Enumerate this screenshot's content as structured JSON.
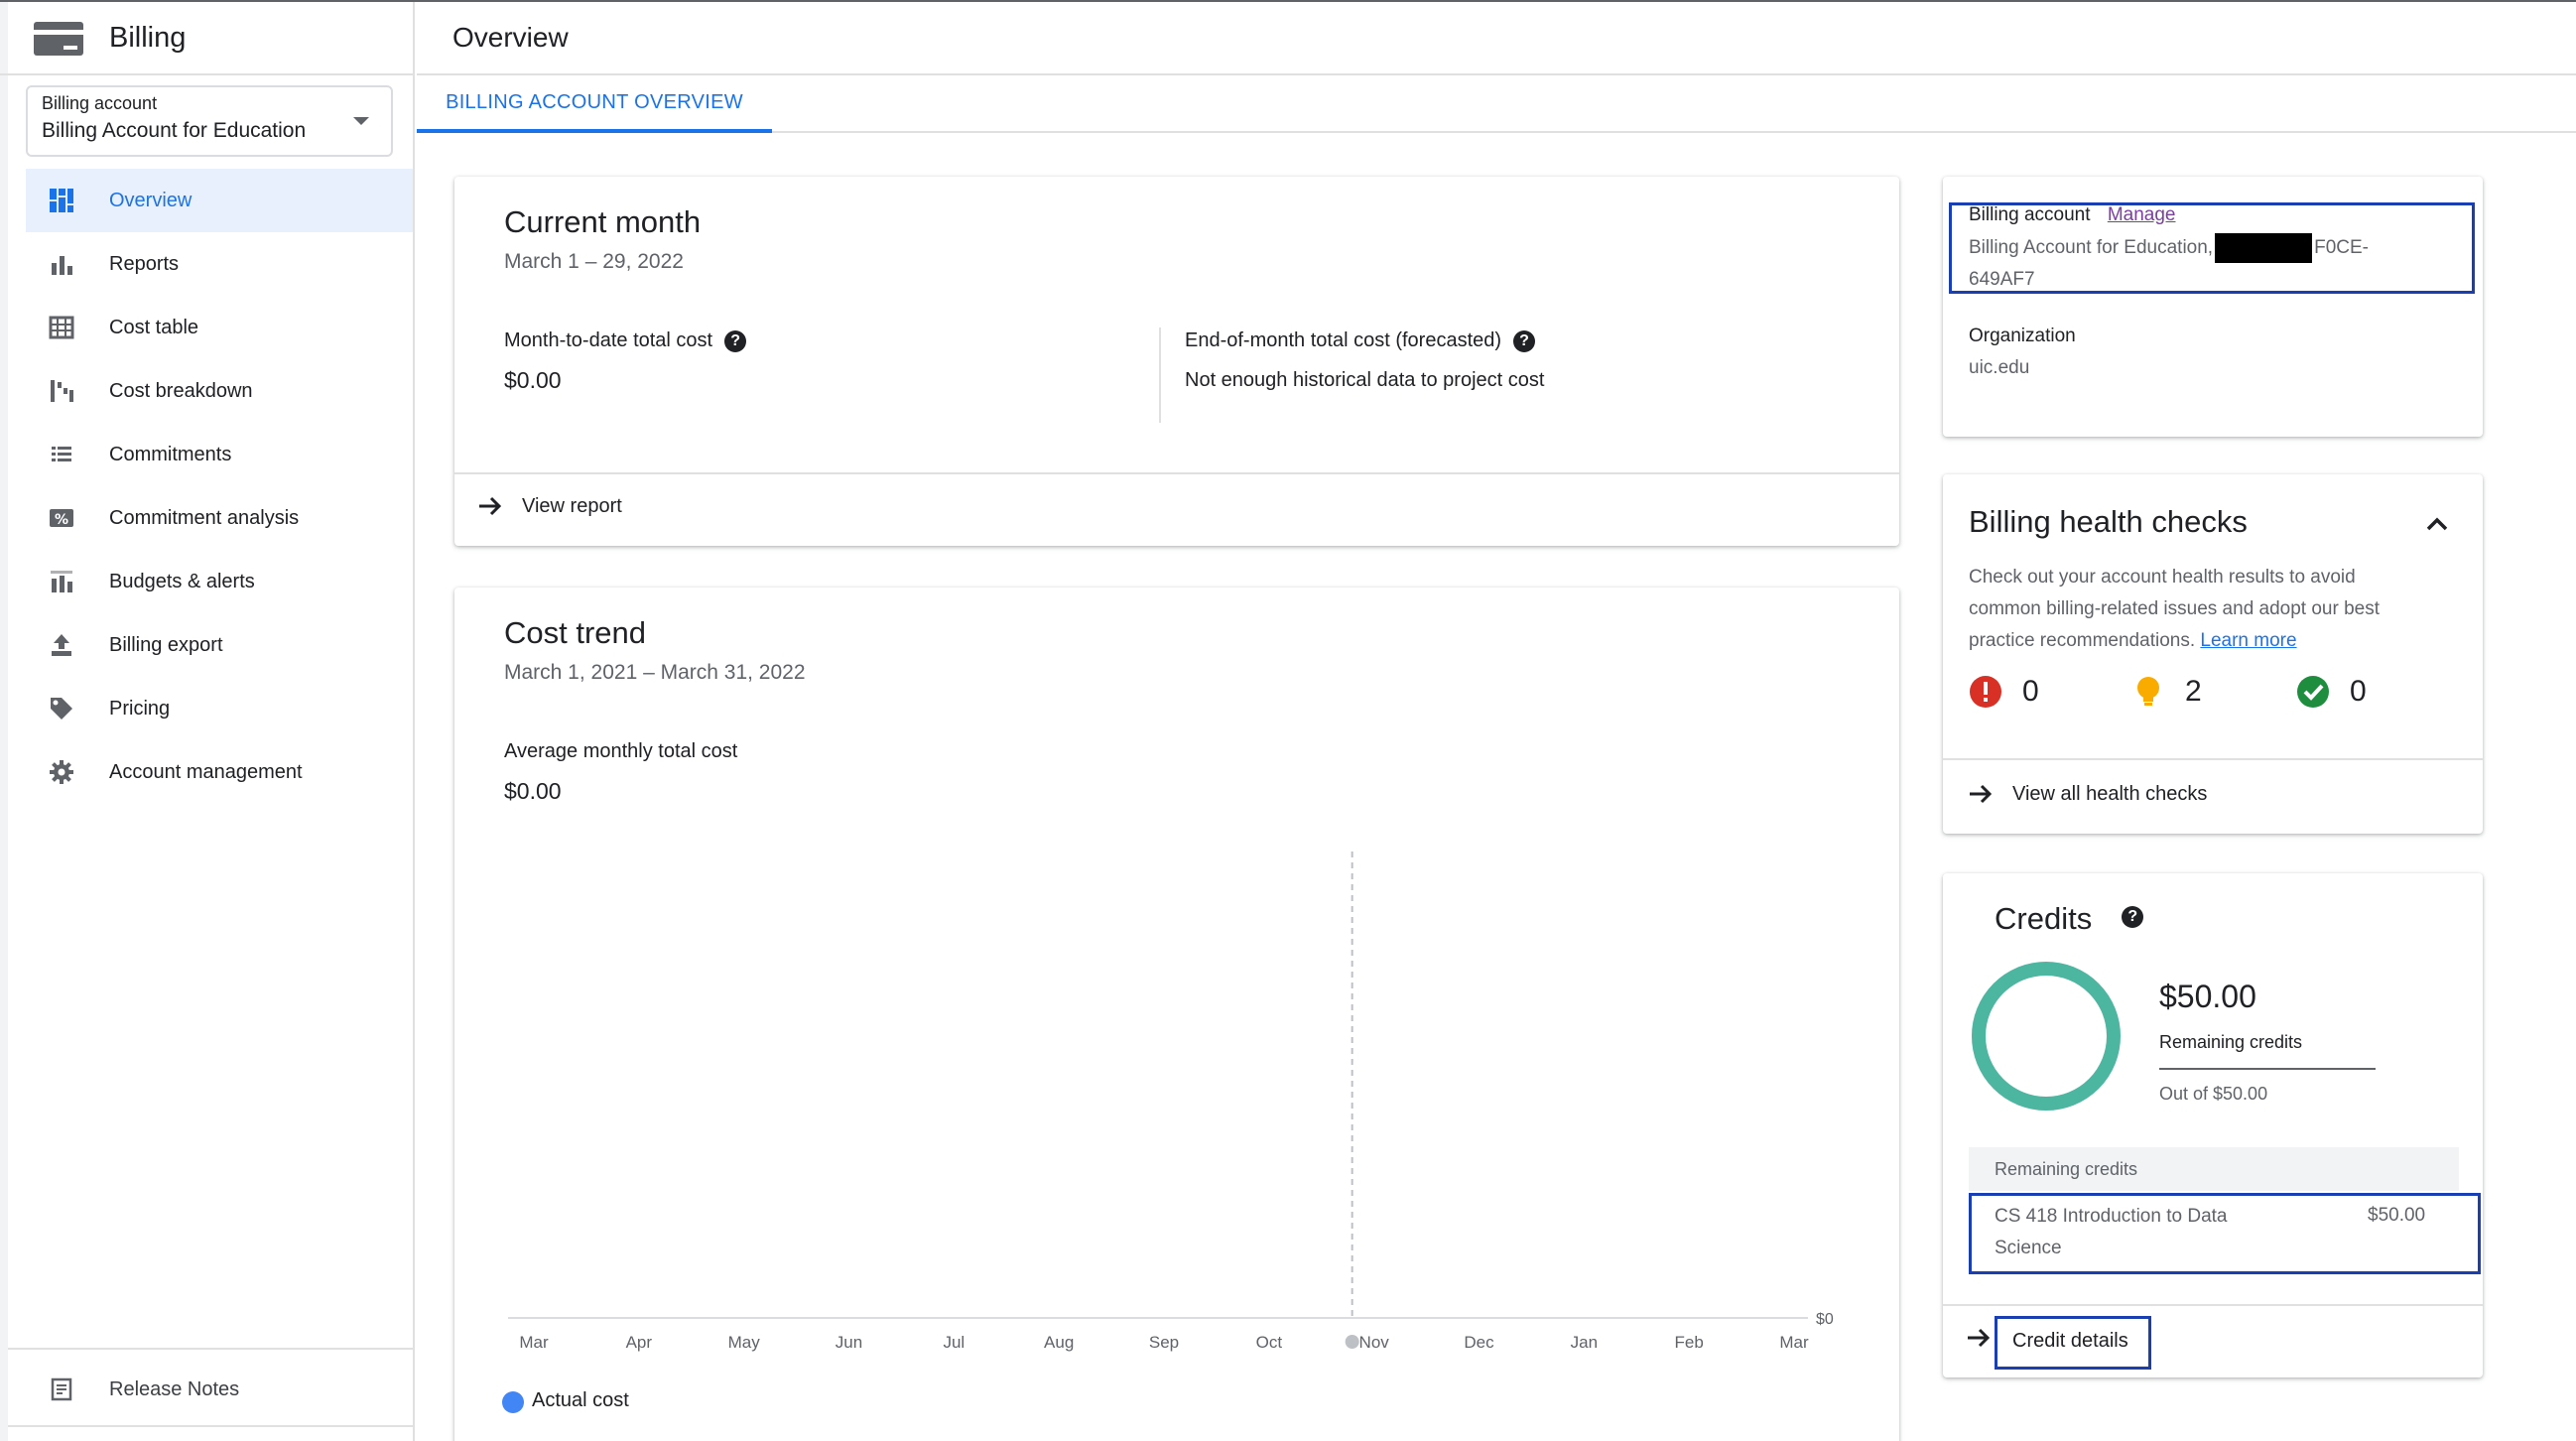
{
  "sidebar": {
    "title": "Billing",
    "account_select": {
      "label": "Billing account",
      "value": "Billing Account for Education"
    },
    "items": [
      {
        "label": "Overview",
        "icon": "dashboard-icon",
        "active": true
      },
      {
        "label": "Reports",
        "icon": "bar-chart-icon",
        "active": false
      },
      {
        "label": "Cost table",
        "icon": "table-icon",
        "active": false
      },
      {
        "label": "Cost breakdown",
        "icon": "waterfall-icon",
        "active": false
      },
      {
        "label": "Commitments",
        "icon": "list-icon",
        "active": false
      },
      {
        "label": "Commitment analysis",
        "icon": "percent-icon",
        "active": false
      },
      {
        "label": "Budgets & alerts",
        "icon": "budget-icon",
        "active": false
      },
      {
        "label": "Billing export",
        "icon": "upload-icon",
        "active": false
      },
      {
        "label": "Pricing",
        "icon": "tag-icon",
        "active": false
      },
      {
        "label": "Account management",
        "icon": "gear-icon",
        "active": false
      }
    ],
    "release_notes": "Release Notes"
  },
  "header": {
    "title": "Overview",
    "tab": "BILLING ACCOUNT OVERVIEW"
  },
  "current_month": {
    "title": "Current month",
    "dates": "March 1 – 29, 2022",
    "mtd_label": "Month-to-date total cost",
    "mtd_value": "$0.00",
    "eom_label": "End-of-month total cost (forecasted)",
    "eom_value": "Not enough historical data to project cost",
    "view_report": "View report"
  },
  "cost_trend": {
    "title": "Cost trend",
    "dates": "March 1, 2021 – March 31, 2022",
    "avg_label": "Average monthly total cost",
    "avg_value": "$0.00",
    "legend": "Actual cost"
  },
  "chart_data": {
    "type": "line",
    "categories": [
      "Mar",
      "Apr",
      "May",
      "Jun",
      "Jul",
      "Aug",
      "Sep",
      "Oct",
      "Nov",
      "Dec",
      "Jan",
      "Feb",
      "Mar"
    ],
    "series": [
      {
        "name": "Actual cost",
        "values": [
          null,
          null,
          null,
          null,
          null,
          null,
          null,
          null,
          0,
          null,
          null,
          null,
          null
        ]
      }
    ],
    "y_tick": "$0",
    "marker_category_index": 8,
    "legend_position": "bottom-left",
    "color": "#4285f4"
  },
  "account_info": {
    "label": "Billing account",
    "manage": "Manage",
    "name_prefix": "Billing Account for Education,",
    "id_suffix": "F0CE-",
    "id_line2": "649AF7",
    "org_label": "Organization",
    "org_value": "uic.edu"
  },
  "health": {
    "title": "Billing health checks",
    "desc_line1": "Check out your account health results to avoid",
    "desc_line2": "common billing-related issues and adopt our best",
    "desc_line3": "practice recommendations.",
    "learn_more": "Learn more",
    "errors": "0",
    "warnings": "2",
    "passed": "0",
    "view_all": "View all health checks"
  },
  "credits": {
    "title": "Credits",
    "amount": "$50.00",
    "remaining_label": "Remaining credits",
    "out_of": "Out of $50.00",
    "remaining_fraction": 1.0,
    "table_header": "Remaining credits",
    "row_name_line1": "CS 418 Introduction to Data",
    "row_name_line2": "Science",
    "row_value": "$50.00",
    "details_link": "Credit details"
  },
  "colors": {
    "accent": "#1a73e8",
    "ring": "#4db6a0",
    "error": "#d93025",
    "warning": "#f9ab00",
    "ok": "#1e8e3e"
  }
}
